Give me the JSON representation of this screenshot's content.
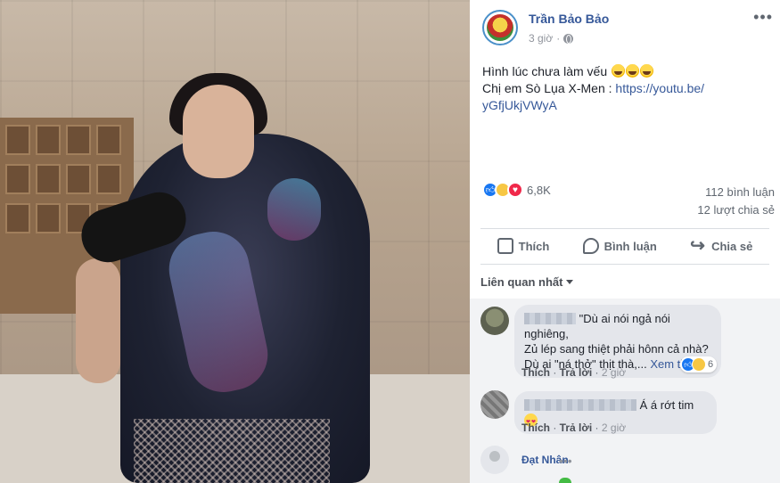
{
  "post": {
    "author": "Trần Bảo Bảo",
    "time": "3 giờ",
    "text_line1": "Hình lúc chưa làm vếu",
    "text_line2_prefix": "Chị em Sò Lụa X-Men : ",
    "link_part1": "https://youtu.be/",
    "link_part2": "yGfjUkjVWyA",
    "reaction_count": "6,8K",
    "comment_count": "112 bình luận",
    "share_count": "12 lượt chia sẻ"
  },
  "actions": {
    "like": "Thích",
    "comment": "Bình luận",
    "share": "Chia sẻ"
  },
  "sort": {
    "label": "Liên quan nhất"
  },
  "comments": [
    {
      "text_line1": "\"Dù ai nói ngả nói nghiêng,",
      "text_line2": "Zủ lép sang thiệt phải hônn cả nhà?",
      "text_line3": "Dù ai \"ná thở\" thịt thà,...",
      "see_more": "Xem thêm",
      "like_label": "Thích",
      "reply_label": "Trả lời",
      "time": "2 giờ",
      "reaction_count": "6"
    },
    {
      "text": "Á á rớt tim",
      "like_label": "Thích",
      "reply_label": "Trả lời",
      "time": "2 giờ"
    }
  ],
  "reply": {
    "name": "Đạt Nhân",
    "more": "•••"
  },
  "colors": {
    "link": "#365899",
    "muted": "#606770",
    "like_blue": "#1877f2",
    "love_red": "#f0284a"
  },
  "icons": [
    "more-icon",
    "globe-icon",
    "like-icon",
    "comment-icon",
    "share-icon",
    "caret-down-icon"
  ]
}
